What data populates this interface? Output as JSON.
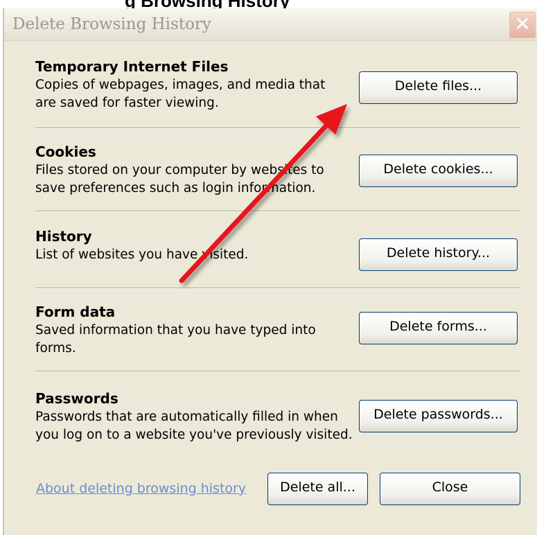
{
  "top_cut_text": "g Browsing History",
  "window": {
    "title": "Delete Browsing History",
    "close_glyph": "✕"
  },
  "sections": [
    {
      "title": "Temporary Internet Files",
      "description": "Copies of webpages, images, and media that are saved for faster viewing.",
      "button": "Delete files..."
    },
    {
      "title": "Cookies",
      "description": "Files stored on your computer by websites to save preferences such as login information.",
      "button": "Delete cookies..."
    },
    {
      "title": "History",
      "description": "List of websites you have visited.",
      "button": "Delete history..."
    },
    {
      "title": "Form data",
      "description": "Saved information that you have typed into forms.",
      "button": "Delete forms..."
    },
    {
      "title": "Passwords",
      "description": "Passwords that are automatically filled in when you log on to a website you've previously visited.",
      "button": "Delete passwords..."
    }
  ],
  "footer": {
    "link": "About deleting browsing history",
    "delete_all": "Delete all...",
    "close": "Close"
  },
  "colors": {
    "dialog_bg": "#ece9d8",
    "arrow": "#e8151b",
    "link": "#6c8ccc",
    "button_border": "#003c74"
  }
}
